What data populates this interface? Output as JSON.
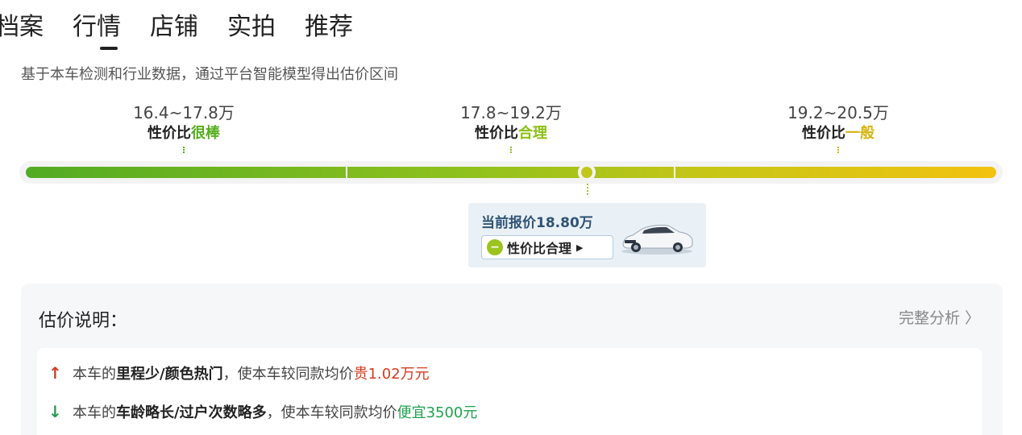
{
  "tabs": [
    {
      "label": "档案"
    },
    {
      "label": "行情"
    },
    {
      "label": "店铺"
    },
    {
      "label": "实拍"
    },
    {
      "label": "推荐"
    }
  ],
  "subtitle": "基于本车检测和行业数据，通过平台智能模型得出估价区间",
  "ranges": [
    {
      "price": "16.4~17.8万",
      "label_prefix": "性价比",
      "label_accent": "很棒",
      "accent_color": "#55ad1c"
    },
    {
      "price": "17.8~19.2万",
      "label_prefix": "性价比",
      "label_accent": "合理",
      "accent_color": "#8cbf14"
    },
    {
      "price": "19.2~20.5万",
      "label_prefix": "性价比",
      "label_accent": "一般",
      "accent_color": "#d8b30c"
    }
  ],
  "current": {
    "title": "当前报价18.80万",
    "badge_icon": "minus-circle-icon",
    "badge_label": "性价比合理",
    "badge_arrow": "▶",
    "price_value_wan": 18.8,
    "scale_min_wan": 16.4,
    "scale_max_wan": 20.5
  },
  "panel": {
    "title": "估价说明：",
    "link": "完整分析 〉",
    "items": [
      {
        "direction": "up",
        "arrow": "↑",
        "prefix": "本车的",
        "highlight": "里程少/颜色热门",
        "middle": "，使本车较同款均价",
        "result": "贵",
        "amount": "1.02万元"
      },
      {
        "direction": "down",
        "arrow": "↓",
        "prefix": "本车的",
        "highlight": "车龄略长/过户次数略多",
        "middle": "，使本车较同款均价",
        "result": "便宜",
        "amount": "3500元"
      }
    ]
  },
  "colors": {
    "accent_up": "#d53b1f",
    "accent_down": "#20a04f",
    "card_title": "#2f5375"
  }
}
